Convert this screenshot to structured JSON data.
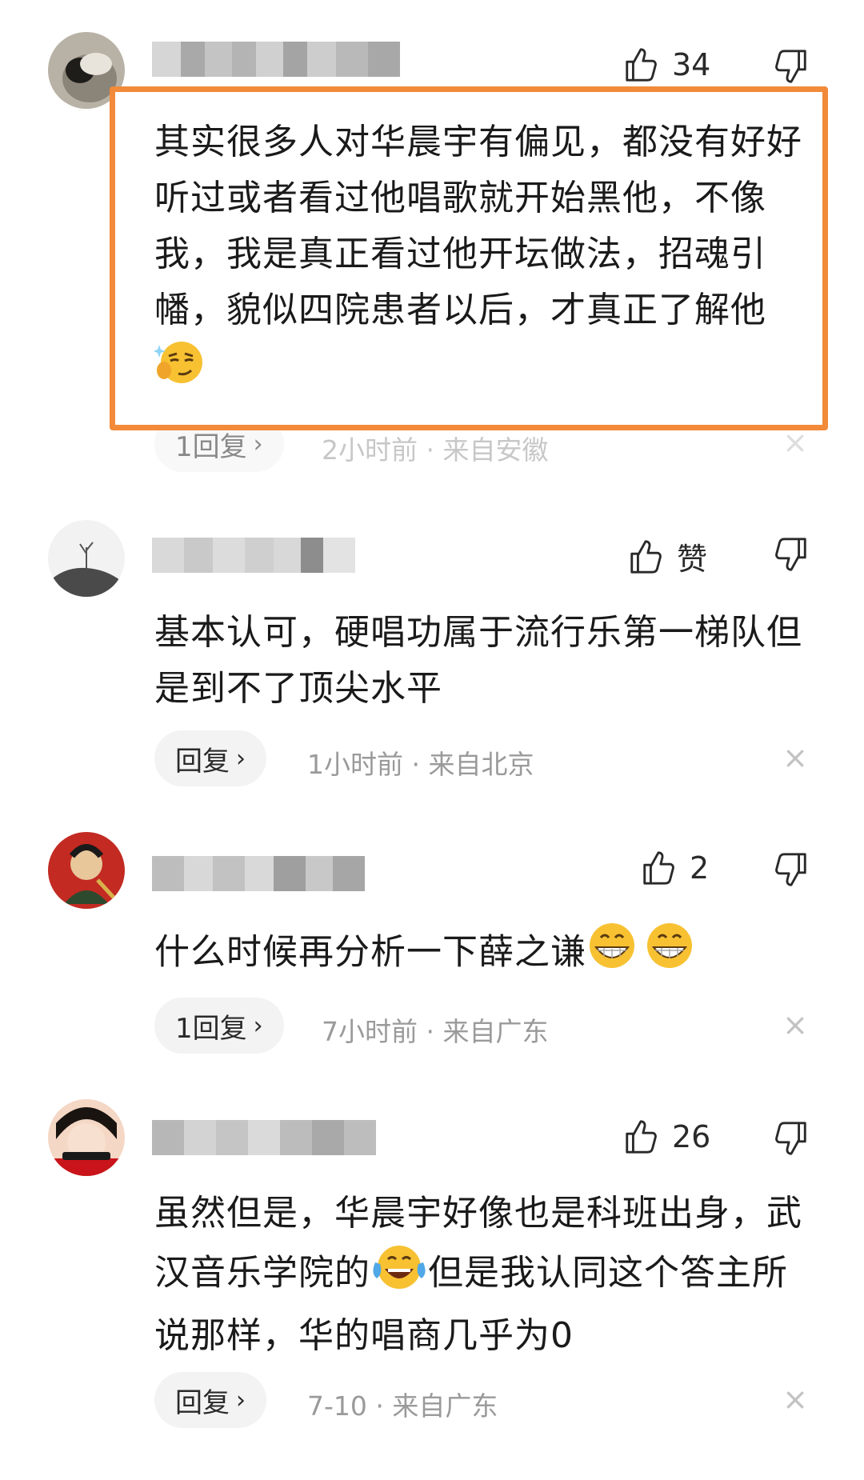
{
  "comments": [
    {
      "likes": "34",
      "text": "其实很多人对华晨宇有偏见，都没有好好听过或者看过他唱歌就开始黑他，不像我，我是真正看过他开坛做法，招魂引幡，貌似四院患者以后，才真正了解他",
      "reply_label": "1回复",
      "time": "2小时前 · 来自安徽",
      "emoji": "smirk-emoji"
    },
    {
      "likes": "赞",
      "text": "基本认可，硬唱功属于流行乐第一梯队但是到不了顶尖水平",
      "reply_label": "回复",
      "time": "1小时前 · 来自北京"
    },
    {
      "likes": "2",
      "text": "什么时候再分析一下薛之谦",
      "reply_label": "1回复",
      "time": "7小时前 · 来自广东",
      "emoji": "grin-emoji"
    },
    {
      "likes": "26",
      "text_a": "虽然但是，华晨宇好像也是科班出身，武汉音乐学院的",
      "text_b": "但是我认同这个答主所说那样，华的唱商几乎为0",
      "reply_label": "回复",
      "time": "7-10 · 来自广东",
      "emoji": "laugh-cry-emoji"
    }
  ],
  "ui": {
    "close_glyph": "×",
    "chevron_glyph": "›"
  },
  "colors": {
    "highlight_border": "#f28a3a",
    "meta_text": "#9a9a9a",
    "pill_bg": "#f3f3f3"
  }
}
